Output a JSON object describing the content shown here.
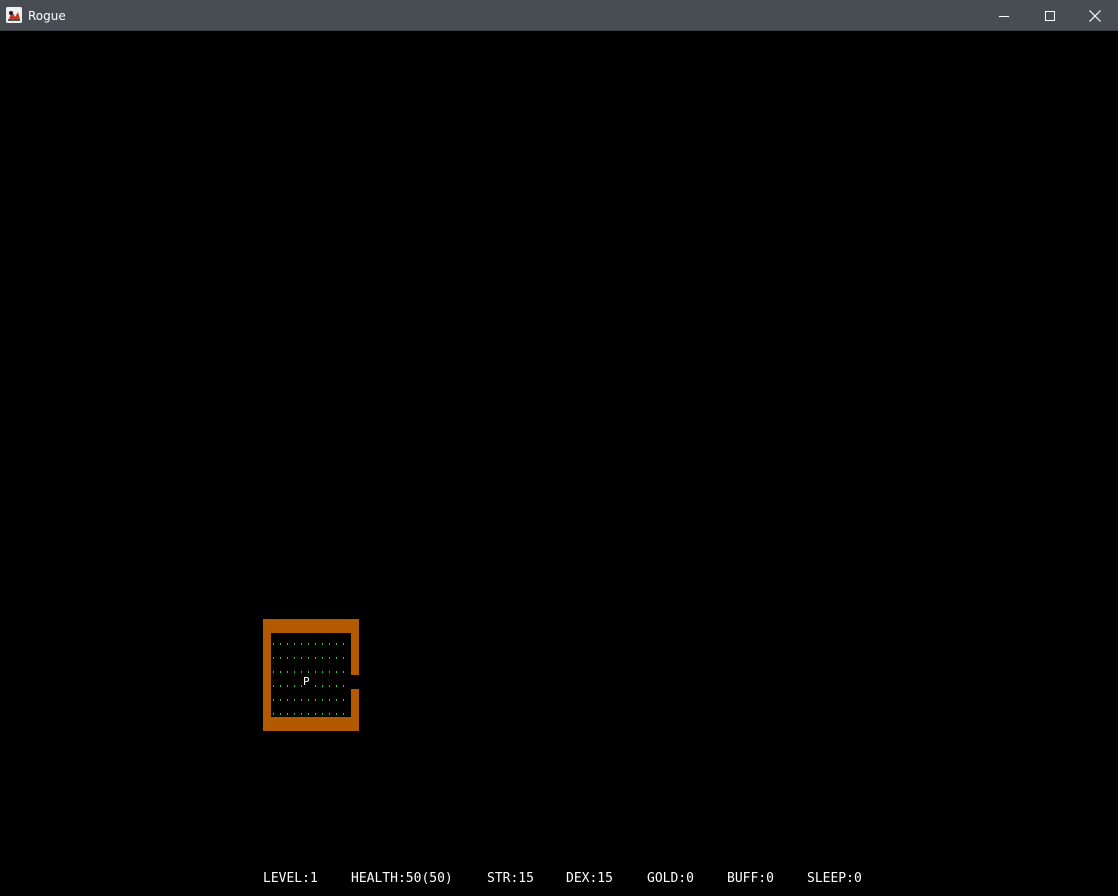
{
  "window": {
    "title": "Rogue",
    "icon": "rogue-app-icon",
    "controls": {
      "minimize_icon": "minimize-icon",
      "maximize_icon": "maximize-icon",
      "close_icon": "close-icon"
    }
  },
  "map": {
    "background_color": "#000000",
    "wall_color": "#b35a00",
    "floor_color": "#1fd150",
    "player_symbol": "P",
    "player_color": "#ffffff"
  },
  "status": {
    "level": "LEVEL:1",
    "health": "HEALTH:50(50)",
    "str": "STR:15",
    "dex": "DEX:15",
    "gold": "GOLD:0",
    "buff": "BUFF:0",
    "sleep": "SLEEP:0"
  }
}
